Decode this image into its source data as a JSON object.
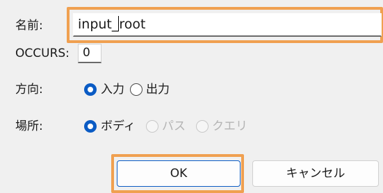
{
  "labels": {
    "name": "名前:",
    "occurs": "OCCURS:",
    "direction": "方向:",
    "location": "場所:"
  },
  "name_input": {
    "value": "input_root"
  },
  "occurs_input": {
    "value": "0"
  },
  "direction_options": [
    {
      "label": "入力",
      "selected": true
    },
    {
      "label": "出力",
      "selected": false
    }
  ],
  "location_options": [
    {
      "label": "ボディ",
      "selected": true,
      "enabled": true
    },
    {
      "label": "パス",
      "selected": false,
      "enabled": false
    },
    {
      "label": "クエリ",
      "selected": false,
      "enabled": false
    }
  ],
  "buttons": {
    "ok": "OK",
    "cancel": "キャンセル"
  },
  "colors": {
    "highlight": "#f0a050",
    "accent": "#0a5bc4",
    "disabled_text": "#b4b4b4"
  }
}
